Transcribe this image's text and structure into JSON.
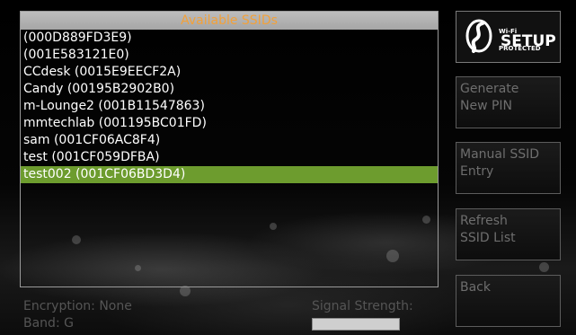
{
  "ssid_panel": {
    "header": "Available SSIDs",
    "items": [
      {
        "label": " (000D889FD3E9)",
        "selected": false
      },
      {
        "label": "(001E583121E0)",
        "selected": false
      },
      {
        "label": "CCdesk (0015E9EECF2A)",
        "selected": false
      },
      {
        "label": "Candy (00195B2902B0)",
        "selected": false
      },
      {
        "label": "m-Lounge2 (001B11547863)",
        "selected": false
      },
      {
        "label": "mmtechlab (001195BC01FD)",
        "selected": false
      },
      {
        "label": "sam (001CF06AC8F4)",
        "selected": false
      },
      {
        "label": "test (001CF059DFBA)",
        "selected": false
      },
      {
        "label": "test002 (001CF06BD3D4)",
        "selected": true
      }
    ]
  },
  "status": {
    "encryption": "Encryption: None",
    "band": "Band: G",
    "signal_label": "Signal Strength:"
  },
  "buttons": {
    "wps": {
      "small_text": "Wi-Fi PROTECTED",
      "big_text": "SETUP"
    },
    "generate_pin": {
      "line1": "Generate",
      "line2": "New PIN"
    },
    "manual_ssid": {
      "line1": "Manual SSID",
      "line2": "Entry"
    },
    "refresh": {
      "line1": "Refresh",
      "line2": "SSID List"
    },
    "back": {
      "line1": "Back"
    }
  },
  "colors": {
    "header_text": "#f2a13a",
    "selected_row": "#6d9c2e",
    "disabled_text": "#6e6e6e"
  }
}
